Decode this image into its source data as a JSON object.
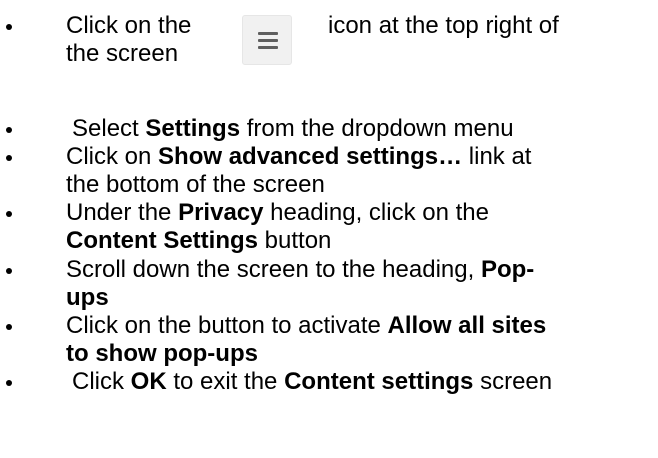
{
  "instructions": [
    {
      "lines": [
        [
          {
            "t": "Click on the"
          }
        ],
        [
          {
            "t": "the screen"
          }
        ]
      ],
      "after_icon": "icon at the top right of",
      "icon": "hamburger-menu-icon"
    },
    {
      "lines": [
        [
          {
            "t": "Select "
          },
          {
            "t": "Settings",
            "b": true
          },
          {
            "t": " from the dropdown menu"
          }
        ]
      ]
    },
    {
      "lines": [
        [
          {
            "t": "Click on "
          },
          {
            "t": "Show advanced settings…",
            "b": true
          },
          {
            "t": " link at"
          }
        ],
        [
          {
            "t": "the bottom of the screen"
          }
        ]
      ]
    },
    {
      "lines": [
        [
          {
            "t": "Under the "
          },
          {
            "t": "Privacy",
            "b": true
          },
          {
            "t": " heading, click on the"
          }
        ],
        [
          {
            "t": "Content Settings",
            "b": true
          },
          {
            "t": " button"
          }
        ]
      ]
    },
    {
      "lines": [
        [
          {
            "t": "Scroll down the screen to the heading, "
          },
          {
            "t": "Pop-",
            "b": true
          }
        ],
        [
          {
            "t": "ups",
            "b": true
          }
        ]
      ]
    },
    {
      "lines": [
        [
          {
            "t": "Click on the button to activate "
          },
          {
            "t": "Allow all sites",
            "b": true
          }
        ],
        [
          {
            "t": "to show pop-ups",
            "b": true
          }
        ]
      ]
    },
    {
      "lines": [
        [
          {
            "t": "Click "
          },
          {
            "t": "OK",
            "b": true
          },
          {
            "t": " to exit the "
          },
          {
            "t": "Content settings",
            "b": true
          },
          {
            "t": " screen"
          }
        ]
      ]
    }
  ]
}
